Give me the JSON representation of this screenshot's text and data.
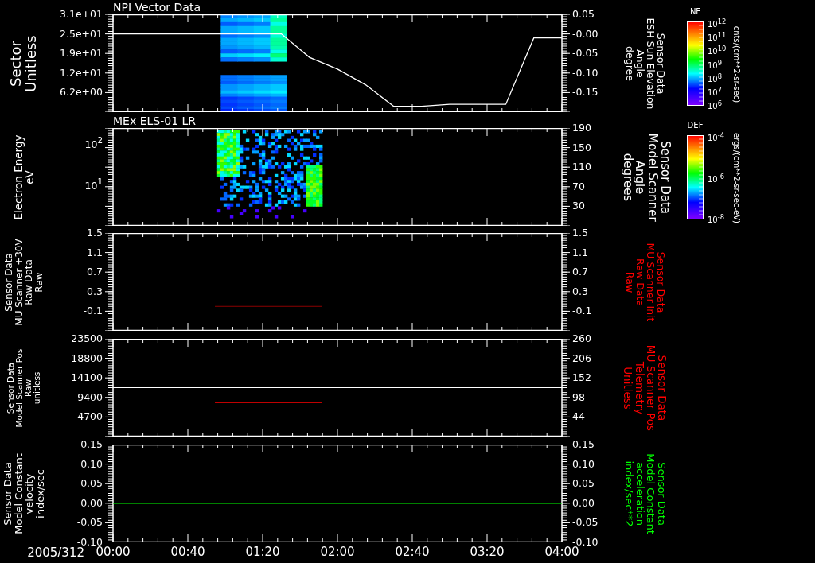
{
  "panels": [
    {
      "kind": "sector",
      "title": "NPI Vector Data",
      "left_label": [
        "Sector",
        "Unitless"
      ],
      "left_ticks": [
        "3.1e+01",
        "2.5e+01",
        "1.9e+01",
        "1.2e+01",
        "6.2e+00"
      ],
      "right_label": [
        "Sensor Data",
        "ESH Sun Elevation",
        "Angle",
        "degree"
      ],
      "color": "#ffffff",
      "colorbar": {
        "label": "NF",
        "ticks": [
          "10$^{12}$",
          "10$^{11}$",
          "10$^{10}$",
          "10$^{9}$",
          "10$^{8}$",
          "10$^{7}$",
          "10$^{6}$"
        ],
        "units": "cnts/(cm**2-sr-sec)"
      },
      "chart_data": {
        "type": "line",
        "ylim": [
          -0.2,
          0.05
        ],
        "categories": [
          null,
          null,
          null,
          null,
          null,
          null,
          null,
          null,
          null,
          null,
          null,
          null,
          null,
          null,
          null,
          null,
          null
        ],
        "yticks": [
          {
            "value": 0.05,
            "label": "0.05"
          },
          {
            "value": 0,
            "label": "-0.00"
          },
          {
            "value": -0.05,
            "label": "-0.05"
          },
          {
            "value": -0.1,
            "label": "-0.10"
          },
          {
            "value": -0.15,
            "label": "-0.15"
          }
        ],
        "series": [
          {
            "color": "#ffffff",
            "values": [
              0.0,
              0.0,
              0.0,
              0.0,
              0.0,
              0.0,
              0.0,
              -0.06,
              -0.09,
              -0.13,
              -0.185,
              -0.185,
              -0.18,
              -0.18,
              -0.18,
              -0.01,
              -0.01
            ]
          }
        ]
      }
    },
    {
      "kind": "energy",
      "title": "MEx ELS-01 LR",
      "left_label": [
        "Electron Energy",
        "eV"
      ],
      "left_ticks": [
        "10$^{2}$",
        "10$^{1}$"
      ],
      "right_ticks": [
        "190",
        "150",
        "110",
        "70",
        "30"
      ],
      "right_label": [
        "Sensor Data",
        "Model Scanner",
        "Angle",
        "degrees"
      ],
      "color": "#ffffff",
      "colorbar": {
        "label": "DEF",
        "ticks": [
          "10$^{-4}$",
          "10$^{-6}$",
          "10$^{-8}$"
        ],
        "units": "ergs/(cm**2-sr-sec-eV)"
      }
    },
    {
      "kind": "raw",
      "left_label": [
        "Sensor Data",
        "MU Scanner +30V",
        "Raw Data",
        "Raw"
      ],
      "left_ticks": [
        "1.5",
        "1.1",
        "0.7",
        "0.3",
        "-0.1"
      ],
      "right_ticks": [
        "1.5",
        "1.1",
        "0.7",
        "0.3",
        "-0.1"
      ],
      "right_label": [
        "Sensor Data",
        "MU Scanner Init",
        "Raw Data",
        "Raw"
      ],
      "color": "#ff0000"
    },
    {
      "kind": "position",
      "left_label": [
        "Sensor Data",
        "Model Scanner Pos",
        "Raw",
        "unitless"
      ],
      "left_ticks": [
        "23500",
        "18800",
        "14100",
        "9400",
        "4700"
      ],
      "right_ticks": [
        "260",
        "206",
        "152",
        "98",
        "44"
      ],
      "right_label": [
        "Sensor Data",
        "MU Scanner Pos",
        "Telemetry",
        "Unitless"
      ],
      "color": "#ff0000"
    },
    {
      "kind": "velocity",
      "left_label": [
        "Sensor Data",
        "Model Constant",
        "velocity",
        "index/sec"
      ],
      "left_ticks": [
        "0.15",
        "0.10",
        "0.05",
        "0.00",
        "-0.05",
        "-0.10"
      ],
      "right_ticks": [
        "0.15",
        "0.10",
        "0.05",
        "0.00",
        "-0.05",
        "-0.10"
      ],
      "right_label": [
        "Sensor Data",
        "Model Constant",
        "acceleration",
        "index/sec**2"
      ],
      "color": "#00ff00"
    }
  ],
  "time_axis": {
    "date": "2005/312",
    "ticks": [
      "00:00",
      "00:40",
      "01:20",
      "02:00",
      "02:40",
      "03:20",
      "04:00"
    ]
  }
}
